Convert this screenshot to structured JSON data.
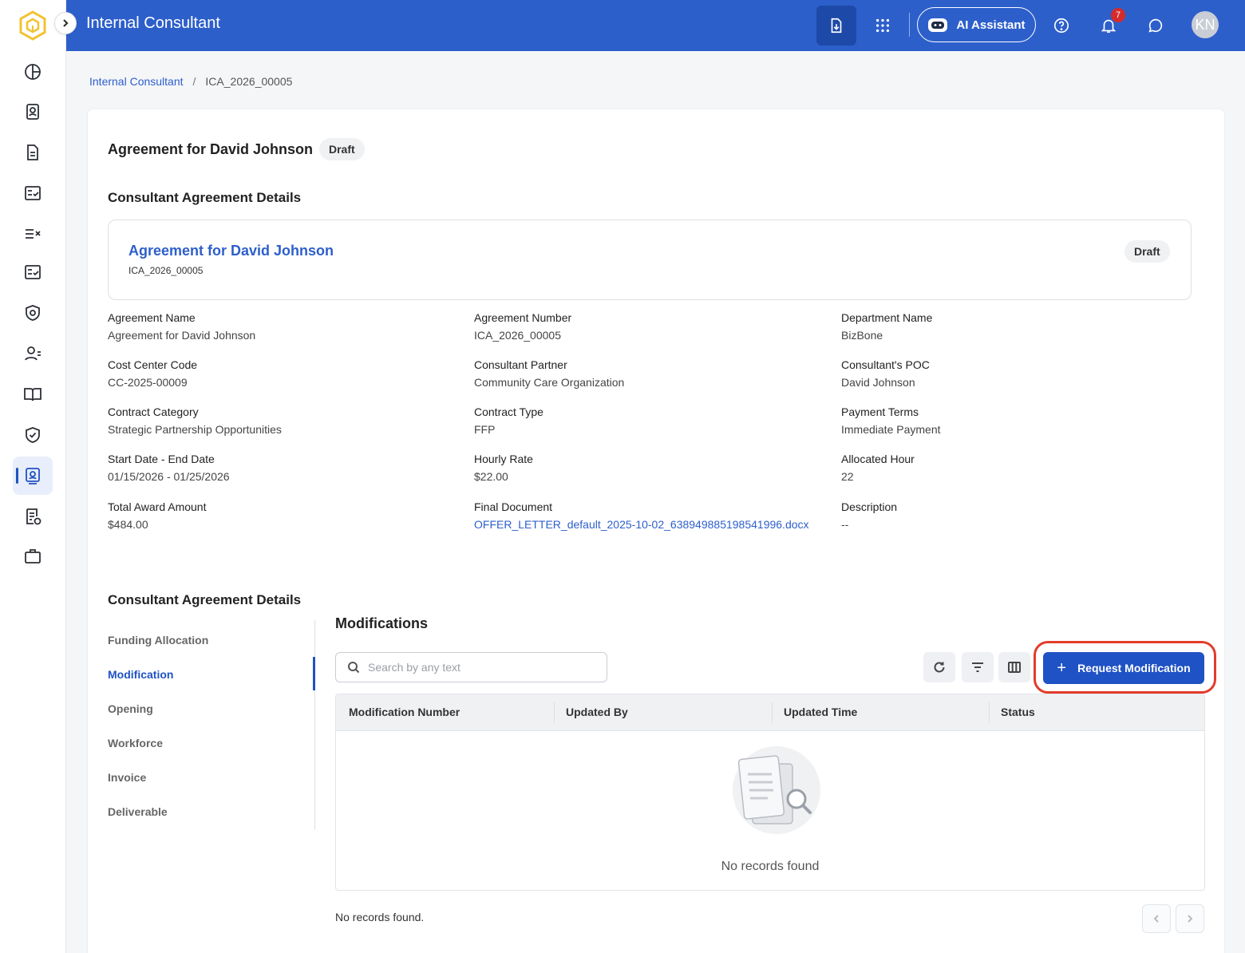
{
  "header": {
    "app_title": "Internal Consultant",
    "ai_assistant_label": "AI Assistant",
    "notification_count": "7",
    "avatar_initials": "KN",
    "accent_color": "#2d5fcb"
  },
  "sidebar": {
    "items": [
      {
        "icon": "dashboard-icon"
      },
      {
        "icon": "contacts-icon"
      },
      {
        "icon": "document-icon"
      },
      {
        "icon": "checklist-icon"
      },
      {
        "icon": "task-list-icon"
      },
      {
        "icon": "checklist-alt-icon"
      },
      {
        "icon": "security-badge-icon"
      },
      {
        "icon": "user-minus-icon"
      },
      {
        "icon": "book-icon"
      },
      {
        "icon": "shield-check-icon"
      },
      {
        "icon": "consultant-icon",
        "active": true
      },
      {
        "icon": "report-approved-icon"
      },
      {
        "icon": "briefcase-icon"
      }
    ]
  },
  "breadcrumb": {
    "parent": "Internal Consultant",
    "separator": "/",
    "current": "ICA_2026_00005"
  },
  "page": {
    "title": "Agreement for David  Johnson",
    "status": "Draft",
    "details_title": "Consultant Agreement Details",
    "tabs_title": "Consultant Agreement Details"
  },
  "summary": {
    "name": "Agreement for David Johnson",
    "number": "ICA_2026_00005",
    "status": "Draft"
  },
  "fields": [
    {
      "label": "Agreement Name",
      "value": "Agreement for David Johnson"
    },
    {
      "label": "Agreement Number",
      "value": "ICA_2026_00005"
    },
    {
      "label": "Department Name",
      "value": "BizBone"
    },
    {
      "label": "Cost Center Code",
      "value": "CC-2025-00009"
    },
    {
      "label": "Consultant Partner",
      "value": "Community Care Organization"
    },
    {
      "label": "Consultant's POC",
      "value": "David Johnson"
    },
    {
      "label": "Contract Category",
      "value": "Strategic Partnership Opportunities"
    },
    {
      "label": "Contract Type",
      "value": "FFP"
    },
    {
      "label": "Payment Terms",
      "value": "Immediate Payment"
    },
    {
      "label": "Start Date - End Date",
      "value": "01/15/2026 - 01/25/2026"
    },
    {
      "label": "Hourly Rate",
      "value": "$22.00"
    },
    {
      "label": "Allocated Hour",
      "value": "22"
    },
    {
      "label": "Total Award Amount",
      "value": "$484.00"
    },
    {
      "label": "Final Document",
      "value": "OFFER_LETTER_default_2025-10-02_638949885198541996.docx"
    },
    {
      "label": "Description",
      "value": "--"
    }
  ],
  "tabs": [
    {
      "label": "Funding Allocation"
    },
    {
      "label": "Modification",
      "active": true
    },
    {
      "label": "Opening"
    },
    {
      "label": "Workforce"
    },
    {
      "label": "Invoice"
    },
    {
      "label": "Deliverable"
    }
  ],
  "modifications": {
    "title": "Modifications",
    "search_placeholder": "Search by any text",
    "request_button": "Request Modification",
    "columns": [
      "Modification Number",
      "Updated By",
      "Updated Time",
      "Status"
    ],
    "empty_text": "No records found",
    "footer_text": "No records found."
  }
}
